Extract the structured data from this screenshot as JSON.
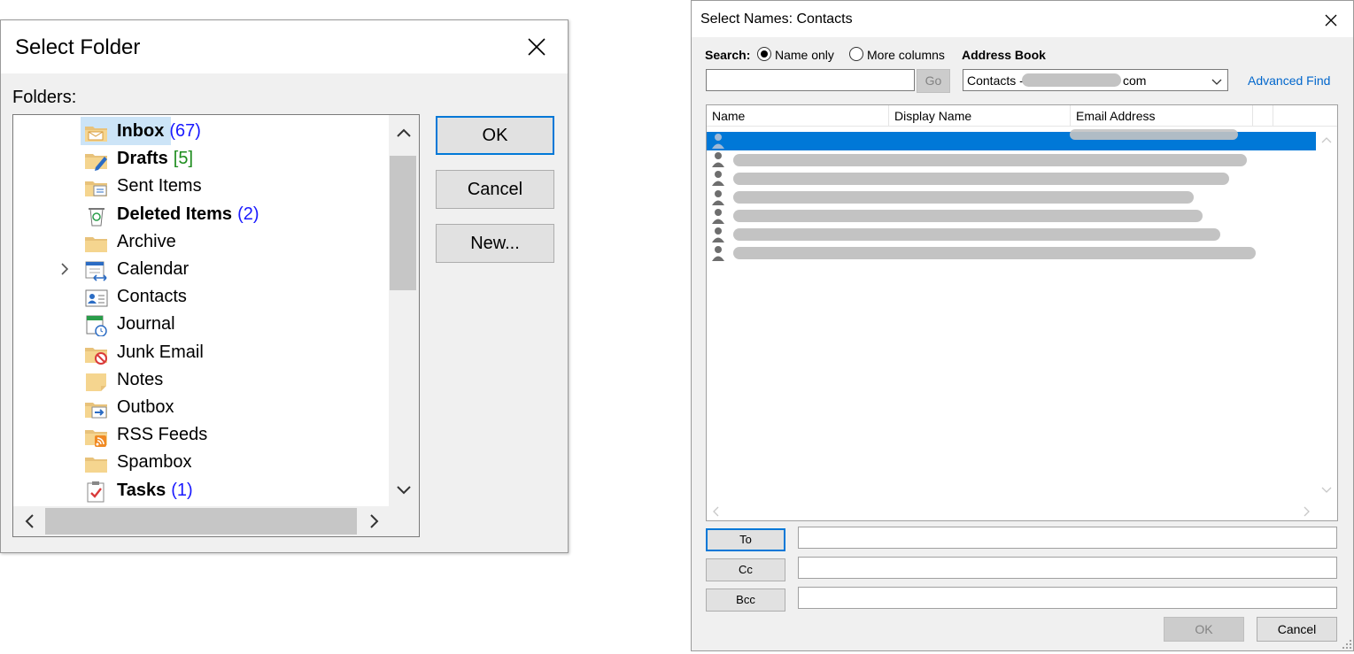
{
  "select_folder": {
    "title": "Select Folder",
    "folders_label": "Folders:",
    "folders": [
      {
        "name": "Inbox",
        "count": "(67)",
        "bold": true,
        "selected": true,
        "icon": "inbox-folder-icon",
        "count_color": "#1a1aff"
      },
      {
        "name": "Drafts",
        "count": "[5]",
        "bold": true,
        "icon": "drafts-folder-icon",
        "count_color": "#1e8c1e"
      },
      {
        "name": "Sent Items",
        "count": "",
        "bold": false,
        "icon": "sent-items-folder-icon"
      },
      {
        "name": "Deleted Items",
        "count": "(2)",
        "bold": true,
        "icon": "recycle-bin-icon",
        "count_color": "#1a1aff"
      },
      {
        "name": "Archive",
        "count": "",
        "bold": false,
        "icon": "archive-folder-icon"
      },
      {
        "name": "Calendar",
        "count": "",
        "bold": false,
        "icon": "calendar-folder-icon",
        "expandable": true
      },
      {
        "name": "Contacts",
        "count": "",
        "bold": false,
        "icon": "contacts-folder-icon"
      },
      {
        "name": "Journal",
        "count": "",
        "bold": false,
        "icon": "journal-folder-icon"
      },
      {
        "name": "Junk Email",
        "count": "",
        "bold": false,
        "icon": "junk-email-folder-icon"
      },
      {
        "name": "Notes",
        "count": "",
        "bold": false,
        "icon": "notes-folder-icon"
      },
      {
        "name": "Outbox",
        "count": "",
        "bold": false,
        "icon": "outbox-folder-icon"
      },
      {
        "name": "RSS Feeds",
        "count": "",
        "bold": false,
        "icon": "rss-feeds-folder-icon"
      },
      {
        "name": "Spambox",
        "count": "",
        "bold": false,
        "icon": "spambox-folder-icon"
      },
      {
        "name": "Tasks",
        "count": "(1)",
        "bold": true,
        "icon": "tasks-folder-icon",
        "count_color": "#1a1aff"
      }
    ],
    "buttons": {
      "ok": "OK",
      "cancel": "Cancel",
      "new": "New..."
    }
  },
  "select_names": {
    "title": "Select Names: Contacts",
    "search_label": "Search:",
    "radio_name_only": "Name only",
    "radio_more_columns": "More columns",
    "address_book_label": "Address Book",
    "search_value": "",
    "go_label": "Go",
    "address_book_value_prefix": "Contacts -",
    "address_book_value_suffix": "com",
    "advanced_find": "Advanced Find",
    "columns": [
      "Name",
      "Display Name",
      "Email Address"
    ],
    "contacts_count": 7,
    "recipient_buttons": {
      "to": "To",
      "cc": "Cc",
      "bcc": "Bcc"
    },
    "ok_label": "OK",
    "cancel_label": "Cancel"
  },
  "colors": {
    "accent": "#0078d7",
    "selection_light": "#cce4f7",
    "redaction": "#c3c3c3",
    "link": "#0066cc"
  }
}
